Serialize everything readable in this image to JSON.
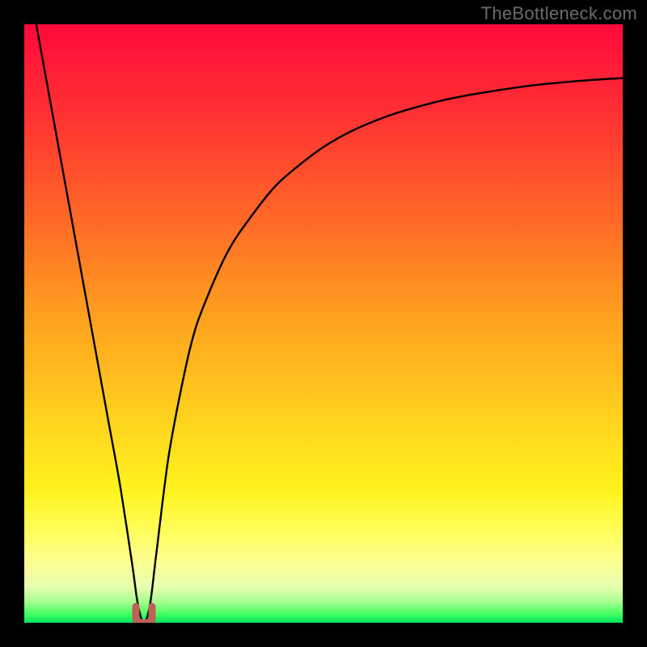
{
  "watermark": "TheBottleneck.com",
  "chart_data": {
    "type": "line",
    "title": "",
    "xlabel": "",
    "ylabel": "",
    "xlim": [
      0,
      100
    ],
    "ylim": [
      0,
      100
    ],
    "grid": false,
    "legend": false,
    "gradient_stops": [
      {
        "offset": 0,
        "color": "#ff0a3a"
      },
      {
        "offset": 0.14,
        "color": "#ff2e33"
      },
      {
        "offset": 0.33,
        "color": "#ff6a26"
      },
      {
        "offset": 0.5,
        "color": "#ffa41e"
      },
      {
        "offset": 0.66,
        "color": "#ffd21e"
      },
      {
        "offset": 0.78,
        "color": "#fff31e"
      },
      {
        "offset": 0.84,
        "color": "#fffd55"
      },
      {
        "offset": 0.9,
        "color": "#fdff93"
      },
      {
        "offset": 0.94,
        "color": "#e6ffb0"
      },
      {
        "offset": 0.965,
        "color": "#a7ff8f"
      },
      {
        "offset": 0.985,
        "color": "#44ff62"
      },
      {
        "offset": 1.0,
        "color": "#00e65e"
      }
    ],
    "series": [
      {
        "name": "bottleneck-curve",
        "x": [
          2,
          4,
          6,
          8,
          10,
          12,
          14,
          16,
          18,
          19,
          20,
          21,
          22,
          24,
          26,
          28,
          30,
          34,
          38,
          42,
          46,
          50,
          55,
          60,
          65,
          70,
          75,
          80,
          85,
          90,
          95,
          100
        ],
        "values": [
          100,
          89,
          78,
          67,
          56,
          45,
          34,
          23,
          10,
          3,
          0,
          3,
          11,
          27,
          38,
          47,
          53,
          62,
          68,
          73,
          76.5,
          79.5,
          82.3,
          84.4,
          86,
          87.3,
          88.3,
          89.1,
          89.8,
          90.3,
          90.7,
          91
        ]
      }
    ],
    "marker": {
      "name": "optimal-marker",
      "x": 20,
      "y": 0,
      "shape": "u",
      "color": "#c06058",
      "stroke_width": 9
    }
  }
}
